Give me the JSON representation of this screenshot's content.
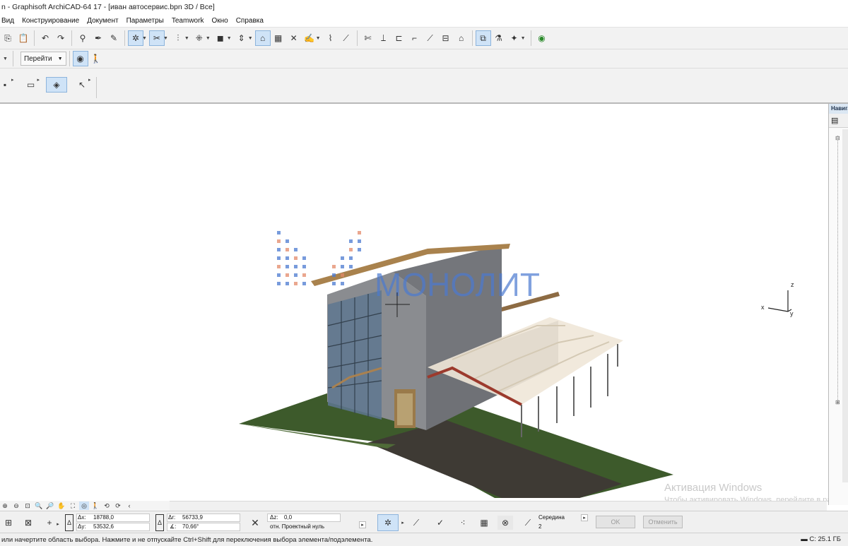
{
  "window": {
    "title": "n - Graphisoft ArchiCAD-64 17 - [иван автосервис.bpn 3D / Все]"
  },
  "menu": {
    "items": [
      "Вид",
      "Конструирование",
      "Документ",
      "Параметры",
      "Teamwork",
      "Окно",
      "Справка"
    ]
  },
  "toolbar2": {
    "goto_label": "Перейти"
  },
  "model": {
    "logo_text": "МОНОЛИТ"
  },
  "axes": {
    "x": "x",
    "y": "y",
    "z": "z"
  },
  "watermark": {
    "title": "Активация Windows",
    "subtitle": "Чтобы активировать Windows, перейдите в раздел \"Параметры\"."
  },
  "navigator": {
    "header": "Навигатор"
  },
  "coords": {
    "dx_label": "Δx:",
    "dx_value": "18788,0",
    "dy_label": "Δy:",
    "dy_value": "53532,6",
    "dr_label": "Δr:",
    "dr_value": "56733,9",
    "angle_label": "∡:",
    "angle_value": "70,66°",
    "dz_label": "Δz:",
    "dz_value": "0,0",
    "ref_label": "отн. Проектный нуль",
    "snap_label": "Середина",
    "snap_value": "2",
    "ok_label": "OK",
    "cancel_label": "Отменить"
  },
  "status": {
    "message": "или начертите область выбора. Нажмите и не отпускайте Ctrl+Shift для переключения выбора элемента/подэлемента.",
    "disk": "C: 25.1 ГБ"
  },
  "colors": {
    "selection_blue": "#cfe3f7",
    "grass": "#3d5a2b",
    "road": "#3e3a34",
    "wall": "#7b7d82",
    "roof_edge": "#a9824d",
    "logo_blue": "#4b7ad1"
  }
}
